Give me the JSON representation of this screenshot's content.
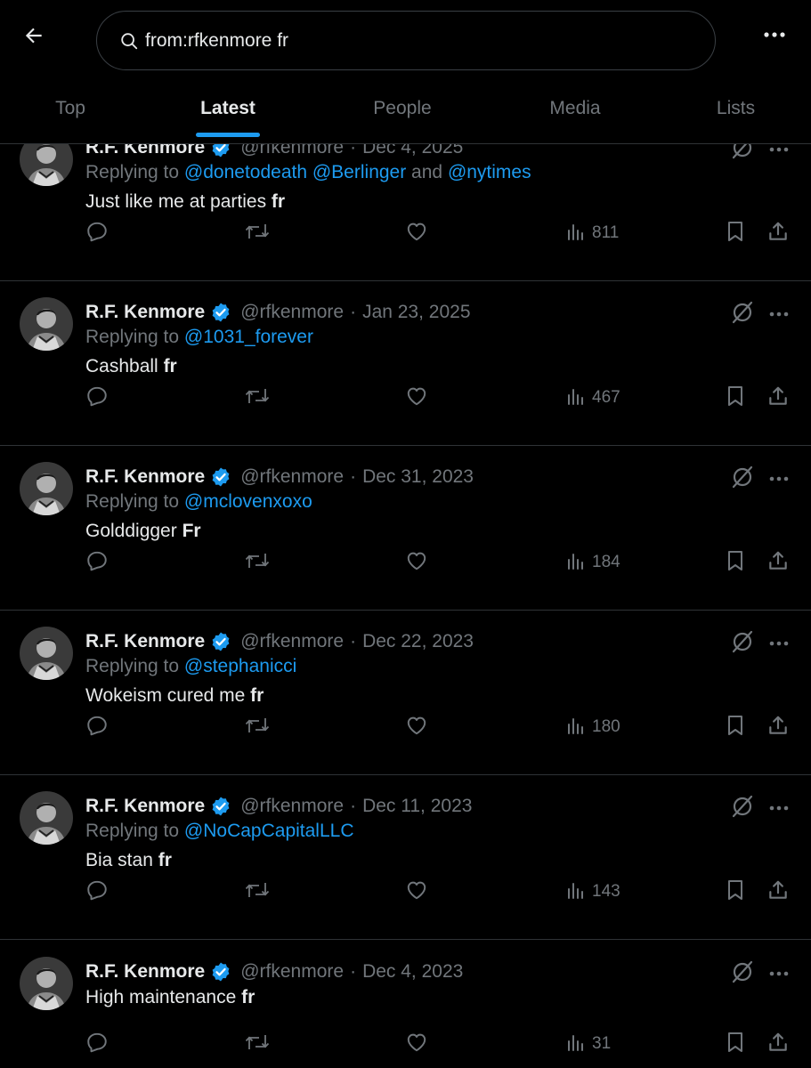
{
  "header": {
    "search_query": "from:rfkenmore fr",
    "tabs": [
      "Top",
      "Latest",
      "People",
      "Media",
      "Lists"
    ],
    "active_tab": "Latest"
  },
  "colors": {
    "background": "#000000",
    "accent": "#1d9bf0",
    "muted": "#71767b",
    "text": "#e7e9ea",
    "divider": "#2f3336"
  },
  "tweets": [
    {
      "name": "R.F. Kenmore",
      "handle": "@rfkenmore",
      "date": "Dec 4, 2025",
      "replying_prefix": "Replying to ",
      "mentions": [
        "@donetodeath",
        "@Berlinger",
        "@nytimes"
      ],
      "mention_join_1": " ",
      "mention_join_2": " and ",
      "text": "Just like me at parties ",
      "keyword": "fr",
      "views": "811"
    },
    {
      "name": "R.F. Kenmore",
      "handle": "@rfkenmore",
      "date": "Jan 23, 2025",
      "replying_prefix": "Replying to ",
      "mentions": [
        "@1031_forever"
      ],
      "text": "Cashball ",
      "keyword": "fr",
      "views": "467"
    },
    {
      "name": "R.F. Kenmore",
      "handle": "@rfkenmore",
      "date": "Dec 31, 2023",
      "replying_prefix": "Replying to ",
      "mentions": [
        "@mclovenxoxo"
      ],
      "text": "Golddigger ",
      "keyword": "Fr",
      "views": "184"
    },
    {
      "name": "R.F. Kenmore",
      "handle": "@rfkenmore",
      "date": "Dec 22, 2023",
      "replying_prefix": "Replying to ",
      "mentions": [
        "@stephanicci"
      ],
      "text": "Wokeism cured me ",
      "keyword": "fr",
      "views": "180"
    },
    {
      "name": "R.F. Kenmore",
      "handle": "@rfkenmore",
      "date": "Dec 11, 2023",
      "replying_prefix": "Replying to ",
      "mentions": [
        "@NoCapCapitalLLC"
      ],
      "text": "Bia stan ",
      "keyword": "fr",
      "views": "143"
    },
    {
      "name": "R.F. Kenmore",
      "handle": "@rfkenmore",
      "date": "Dec 4, 2023",
      "text": "High maintenance ",
      "keyword": "fr",
      "views": "31"
    }
  ],
  "icons": {
    "back": "arrow-left-icon",
    "search": "search-icon",
    "more": "more-horizontal-icon",
    "verified": "verified-badge-icon",
    "grok": "grok-icon",
    "reply": "reply-icon",
    "retweet": "retweet-icon",
    "like": "heart-icon",
    "views": "views-icon",
    "bookmark": "bookmark-icon",
    "share": "share-icon"
  }
}
